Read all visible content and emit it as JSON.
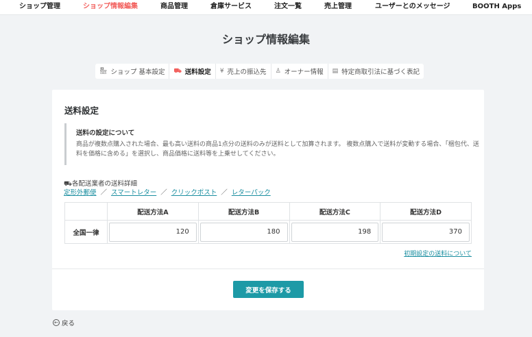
{
  "nav": {
    "items": [
      {
        "label": "ショップ管理"
      },
      {
        "label": "ショップ情報編集"
      },
      {
        "label": "商品管理"
      },
      {
        "label": "倉庫サービス"
      },
      {
        "label": "注文一覧"
      },
      {
        "label": "売上管理"
      },
      {
        "label": "ユーザーとのメッセージ"
      },
      {
        "label": "BOOTH Apps"
      }
    ],
    "active_color": "#f25f5c"
  },
  "page_title": "ショップ情報編集",
  "tabs": [
    {
      "label": "ショップ 基本設定",
      "icon": "shop-icon"
    },
    {
      "label": "送料設定",
      "icon": "truck-icon",
      "active": true
    },
    {
      "label": "売上の振込先",
      "icon": "yen-icon"
    },
    {
      "label": "オーナー情報",
      "icon": "person-icon"
    },
    {
      "label": "特定商取引法に基づく表記",
      "icon": "document-icon"
    }
  ],
  "card": {
    "title": "送料設定",
    "note_title": "送料の設定について",
    "note_text": "商品が複数点購入された場合、最も高い送料の商品1点分の送料のみが送料として加算されます。 複数点購入で送料が変動する場合、「梱包代、送料を価格に含める」を選択し、商品価格に送料等を上乗せしてください。",
    "carrier_label": "各配送業者の送料詳細",
    "carrier_links": [
      "定形外郵便",
      "スマートレター",
      "クリックポスト",
      "レターパック"
    ],
    "carrier_sep": "／",
    "table": {
      "columns": [
        "配送方法A",
        "配送方法B",
        "配送方法C",
        "配送方法D"
      ],
      "row_label": "全国一律",
      "values": [
        "120",
        "180",
        "198",
        "370"
      ]
    },
    "default_link": "初期設定の送料について",
    "save_label": "変更を保存する"
  },
  "back_label": "戻る",
  "colors": {
    "accent": "#1d9aa6",
    "link": "#1a8ea0",
    "background": "#f1f3f5"
  }
}
